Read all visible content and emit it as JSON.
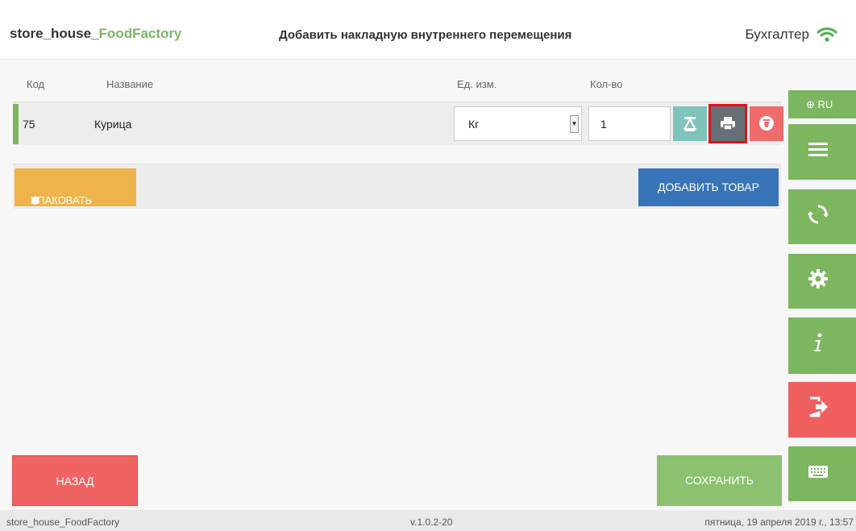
{
  "app": {
    "name_prefix": "store_house_",
    "name_accent": "FoodFactory"
  },
  "header": {
    "title": "Добавить накладную внутреннего перемещения",
    "role": "Бухгалтер"
  },
  "table": {
    "columns": {
      "code": "Код",
      "name": "Название",
      "unit": "Ед. изм.",
      "qty": "Кол-во"
    },
    "rows": [
      {
        "code": "75",
        "name": "Курица",
        "unit": "Кг",
        "qty": "1"
      }
    ]
  },
  "actions": {
    "pack_label": "УПАКОВАТЬ",
    "add_label": "ДОБАВИТЬ ТОВАР"
  },
  "sidebar": {
    "lang_label": "RU"
  },
  "footer_buttons": {
    "back_label": "НАЗАД",
    "save_label": "СОХРАНИТЬ"
  },
  "status_bar": {
    "app_name": "store_house_FoodFactory",
    "version": "v.1.0.2-20",
    "datetime": "пятница, 19 апреля 2019 г., 13:57"
  },
  "icons": {
    "wifi": "wifi-icon",
    "scale": "scale-icon",
    "print": "printer-icon",
    "delete": "trash-icon",
    "pack": "box-icon",
    "globe": "globe-icon",
    "menu": "menu-icon",
    "sync": "sync-icon",
    "settings": "gear-icon",
    "info": "info-icon",
    "logout": "logout-icon",
    "keyboard": "keyboard-icon"
  },
  "colors": {
    "brand_green": "#7cb65f",
    "pack_orange": "#eeb34a",
    "add_blue": "#3874b8",
    "back_red": "#f06363",
    "save_green": "#8cc16f",
    "exit_red": "#f05f5f",
    "scale_teal": "#7fc4bb",
    "print_gray": "#666f75",
    "highlight_red": "#e0121a"
  }
}
